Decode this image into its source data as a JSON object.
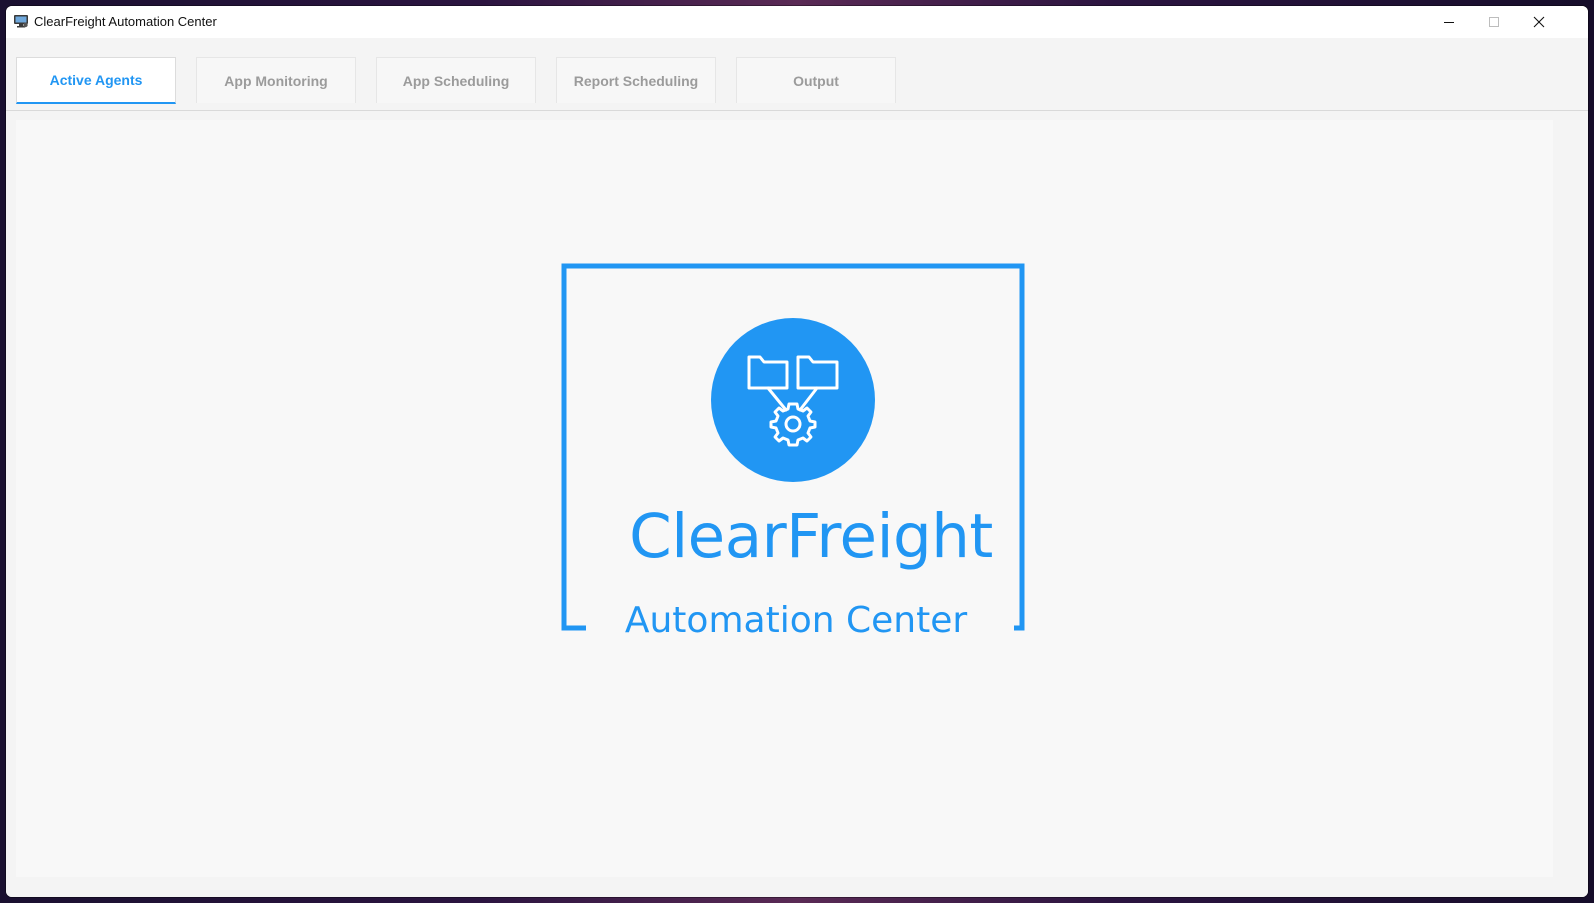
{
  "window": {
    "title": "ClearFreight Automation Center",
    "controls": {
      "minimize_icon": "minimize-icon",
      "maximize_icon": "maximize-icon",
      "close_icon": "close-icon"
    }
  },
  "tabs": [
    {
      "label": "Active Agents",
      "active": true
    },
    {
      "label": "App Monitoring",
      "active": false
    },
    {
      "label": "App Scheduling",
      "active": false
    },
    {
      "label": "Report Scheduling",
      "active": false
    },
    {
      "label": "Output",
      "active": false
    }
  ],
  "logo": {
    "brand": "ClearFreight",
    "tagline": "Automation Center",
    "icon": "folders-gear-icon"
  },
  "colors": {
    "accent": "#2196f3",
    "inactive_tab_text": "#9b9b9b",
    "content_bg": "#f8f8f8"
  }
}
